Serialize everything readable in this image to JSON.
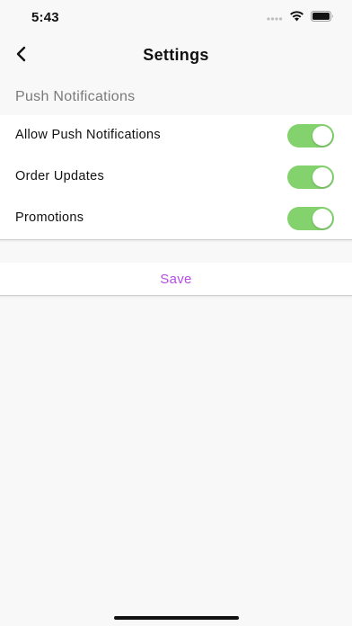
{
  "status_bar": {
    "time": "5:43",
    "icons": [
      "cellular-signal-icon",
      "wifi-icon",
      "battery-icon"
    ]
  },
  "nav": {
    "title": "Settings",
    "back_icon": "chevron-left-icon"
  },
  "section": {
    "title": "Push Notifications"
  },
  "settings": [
    {
      "label": "Allow Push Notifications",
      "enabled": true
    },
    {
      "label": "Order Updates",
      "enabled": true
    },
    {
      "label": "Promotions",
      "enabled": true
    }
  ],
  "save": {
    "label": "Save"
  },
  "colors": {
    "toggle_on": "#83d26d",
    "save_text": "#b84ee6",
    "section_text": "#7a7a7a",
    "background": "#f8f8f8"
  }
}
